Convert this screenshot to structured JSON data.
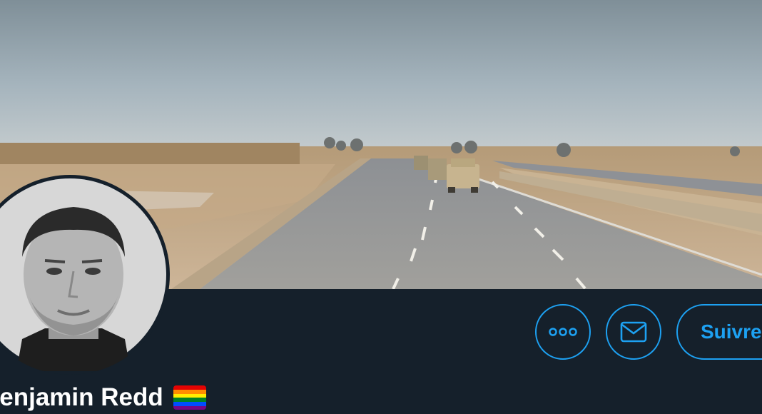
{
  "profile": {
    "display_name": "Benjamin Redd",
    "name_emoji": "rainbow-flag-icon"
  },
  "actions": {
    "more_icon": "more-horizontal-icon",
    "message_icon": "envelope-icon",
    "follow_label": "Suivre"
  },
  "colors": {
    "background": "#15202b",
    "accent": "#1da1f2",
    "text": "#ffffff"
  }
}
